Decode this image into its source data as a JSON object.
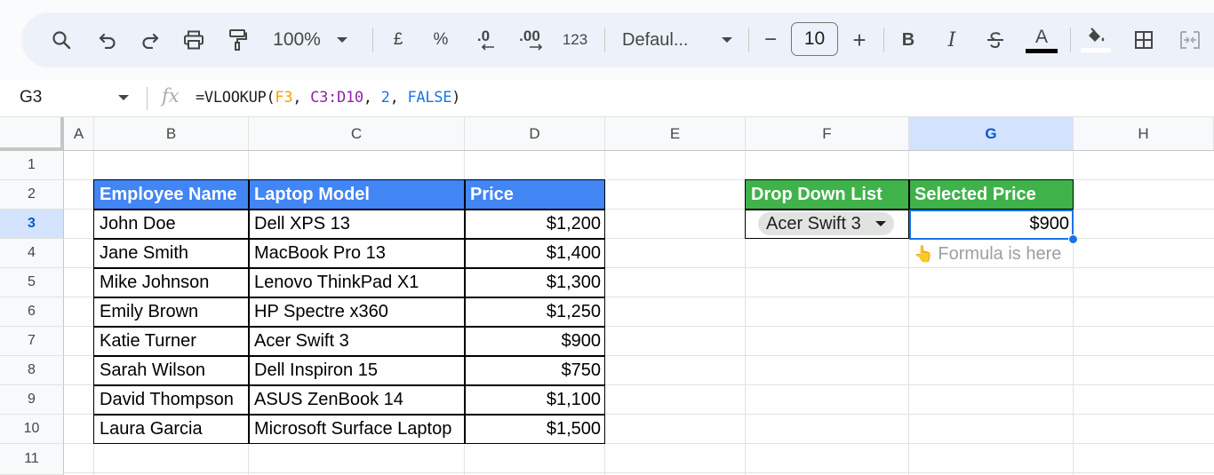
{
  "toolbar": {
    "zoom": "100%",
    "currency_symbol": "£",
    "percent_symbol": "%",
    "decrease_decimal": ".0",
    "increase_decimal": ".00",
    "number_format": "123",
    "font_name": "Defaul...",
    "font_size": "10",
    "minus": "−",
    "plus": "+",
    "bold": "B",
    "italic": "I",
    "text_color_letter": "A"
  },
  "formula_bar": {
    "cell_ref": "G3",
    "fx": "fx",
    "formula_prefix": "=VLOOKUP(",
    "arg1": "F3",
    "sep1": ", ",
    "arg2": "C3:D10",
    "sep2": ", ",
    "arg3": "2",
    "sep3": ", ",
    "arg4": "FALSE",
    "formula_suffix": ")",
    "colors": {
      "arg1": "#f4a300",
      "arg2": "#8e24aa",
      "arg3": "#1a73e8",
      "arg4": "#1a73e8"
    }
  },
  "columns": [
    "A",
    "B",
    "C",
    "D",
    "E",
    "F",
    "G",
    "H"
  ],
  "selected_column": "G",
  "rows": [
    "1",
    "2",
    "3",
    "4",
    "5",
    "6",
    "7",
    "8",
    "9",
    "10",
    "11"
  ],
  "selected_row": "3",
  "table": {
    "headers": [
      "Employee Name",
      "Laptop Model",
      "Price"
    ],
    "rows": [
      [
        "John Doe",
        "Dell XPS 13",
        "$1,200"
      ],
      [
        "Jane Smith",
        "MacBook Pro 13",
        "$1,400"
      ],
      [
        "Mike Johnson",
        "Lenovo ThinkPad X1",
        "$1,300"
      ],
      [
        "Emily Brown",
        "HP Spectre x360",
        "$1,250"
      ],
      [
        "Katie Turner",
        "Acer Swift 3",
        "$900"
      ],
      [
        "Sarah Wilson",
        "Dell Inspiron 15",
        "$750"
      ],
      [
        "David Thompson",
        "ASUS ZenBook 14",
        "$1,100"
      ],
      [
        "Laura Garcia",
        "Microsoft Surface Laptop",
        "$1,500"
      ]
    ],
    "header_color": "#4285f4"
  },
  "lookup": {
    "dropdown_header": "Drop Down List",
    "price_header": "Selected Price",
    "dropdown_value": "Acer Swift 3",
    "selected_price": "$900",
    "hint_emoji": "👆",
    "hint_text": "Formula is here",
    "header_color": "#3fb24a"
  },
  "colors": {
    "selection": "#1a73e8",
    "selected_header_bg": "#d3e3fd"
  }
}
